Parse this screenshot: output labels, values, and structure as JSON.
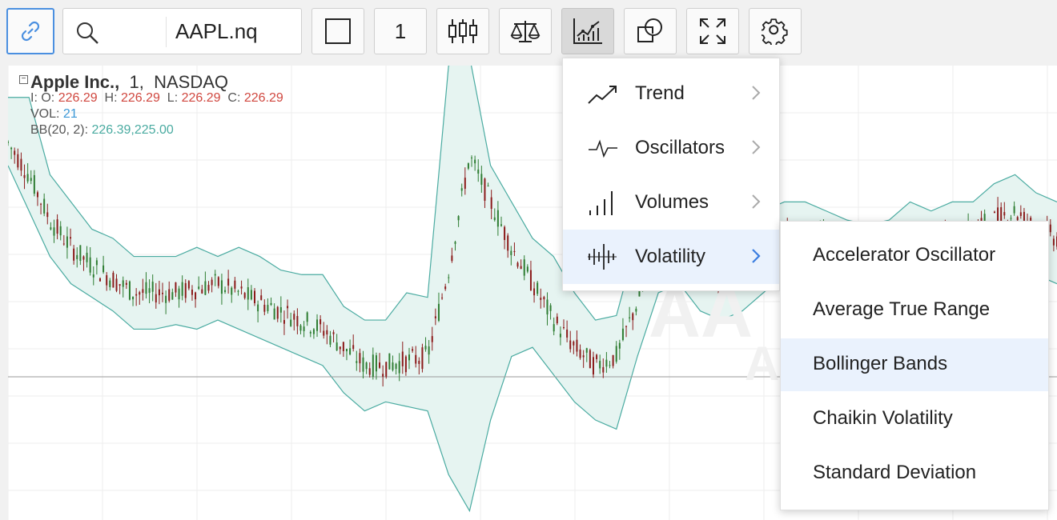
{
  "toolbar": {
    "symbol_value": "AAPL.nq",
    "interval_label": "1",
    "buttons": [
      "link",
      "search",
      "drawing-square",
      "interval",
      "candles",
      "compare",
      "indicators",
      "shapes",
      "fullscreen",
      "settings"
    ]
  },
  "legend": {
    "company": "Apple Inc.,",
    "interval": "1,",
    "exchange": "NASDAQ",
    "ohlc": {
      "prefix": "I: O:",
      "open": "226.29",
      "high_label": "H:",
      "high": "226.29",
      "low_label": "L:",
      "low": "226.29",
      "close_label": "C:",
      "close": "226.29"
    },
    "vol_label": "VOL:",
    "vol_value": "21",
    "bb_label": "BB(20, 2):",
    "bb_value": "226.39,225.00"
  },
  "watermark": {
    "line1": "AA",
    "line2": "A"
  },
  "menu": {
    "items": [
      {
        "label": "Trend",
        "icon": "trend-icon"
      },
      {
        "label": "Oscillators",
        "icon": "oscillator-icon"
      },
      {
        "label": "Volumes",
        "icon": "volume-icon"
      },
      {
        "label": "Volatility",
        "icon": "volatility-icon",
        "selected": true
      }
    ]
  },
  "submenu": {
    "items": [
      {
        "label": "Accelerator Oscillator"
      },
      {
        "label": "Average True Range"
      },
      {
        "label": "Bollinger Bands",
        "highlighted": true
      },
      {
        "label": "Chaikin Volatility"
      },
      {
        "label": "Standard Deviation"
      }
    ]
  },
  "colors": {
    "accent": "#4a8fe0",
    "price_red": "#d0473f",
    "volume_blue": "#3a97d6",
    "band_teal": "#4aaba1",
    "band_fill": "#e6f4f1",
    "candle_up": "#2e7d32",
    "candle_down": "#8b1a1a"
  },
  "chart_data": {
    "type": "candlestick",
    "overlay": "Bollinger Bands",
    "x": [
      0,
      0.02,
      0.04,
      0.06,
      0.08,
      0.1,
      0.12,
      0.14,
      0.16,
      0.18,
      0.2,
      0.22,
      0.24,
      0.26,
      0.28,
      0.3,
      0.32,
      0.34,
      0.36,
      0.38,
      0.4,
      0.42,
      0.44,
      0.46,
      0.48,
      0.5,
      0.52,
      0.54,
      0.56,
      0.58,
      0.6,
      0.62,
      0.64,
      0.66,
      0.68,
      0.7,
      0.72,
      0.74,
      0.76,
      0.78,
      0.8,
      0.82,
      0.84,
      0.86,
      0.88,
      0.9,
      0.92,
      0.94,
      0.96,
      0.98,
      1.0
    ],
    "mid": [
      0.83,
      0.76,
      0.66,
      0.6,
      0.56,
      0.53,
      0.5,
      0.5,
      0.5,
      0.51,
      0.52,
      0.5,
      0.48,
      0.46,
      0.44,
      0.42,
      0.38,
      0.34,
      0.34,
      0.35,
      0.36,
      0.55,
      0.8,
      0.7,
      0.6,
      0.52,
      0.44,
      0.38,
      0.34,
      0.36,
      0.48,
      0.6,
      0.64,
      0.58,
      0.54,
      0.55,
      0.58,
      0.62,
      0.63,
      0.62,
      0.6,
      0.58,
      0.56,
      0.58,
      0.6,
      0.62,
      0.64,
      0.66,
      0.68,
      0.64,
      0.62
    ],
    "upper": [
      0.93,
      0.93,
      0.76,
      0.7,
      0.64,
      0.62,
      0.58,
      0.58,
      0.58,
      0.6,
      0.58,
      0.6,
      0.58,
      0.55,
      0.54,
      0.54,
      0.47,
      0.44,
      0.44,
      0.5,
      0.49,
      1.0,
      1.02,
      0.78,
      0.7,
      0.62,
      0.58,
      0.5,
      0.44,
      0.45,
      0.62,
      0.66,
      0.7,
      0.66,
      0.62,
      0.66,
      0.68,
      0.7,
      0.7,
      0.68,
      0.66,
      0.65,
      0.66,
      0.7,
      0.68,
      0.7,
      0.7,
      0.74,
      0.76,
      0.72,
      0.7
    ],
    "lower": [
      0.78,
      0.68,
      0.58,
      0.52,
      0.49,
      0.46,
      0.42,
      0.42,
      0.43,
      0.42,
      0.44,
      0.42,
      0.4,
      0.38,
      0.36,
      0.34,
      0.28,
      0.24,
      0.26,
      0.25,
      0.24,
      0.1,
      0.02,
      0.22,
      0.36,
      0.38,
      0.32,
      0.26,
      0.22,
      0.2,
      0.36,
      0.5,
      0.52,
      0.46,
      0.44,
      0.46,
      0.5,
      0.54,
      0.56,
      0.54,
      0.52,
      0.5,
      0.48,
      0.5,
      0.52,
      0.54,
      0.56,
      0.6,
      0.6,
      0.54,
      0.52
    ]
  }
}
